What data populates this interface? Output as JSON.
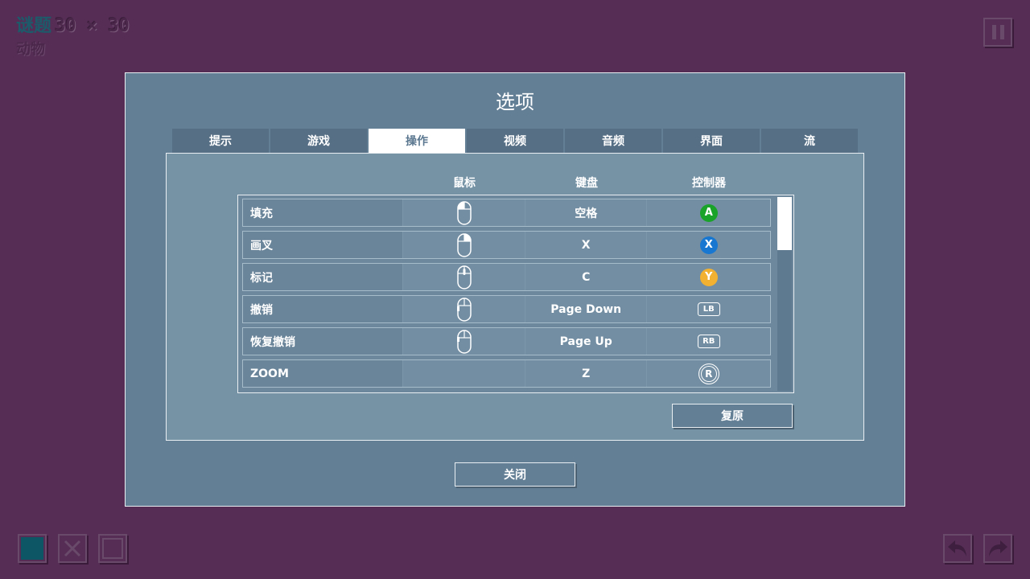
{
  "hud": {
    "puzzle_label": "谜题",
    "puzzle_size": "30 × 30",
    "puzzle_category": "动物"
  },
  "dialog": {
    "title": "选项",
    "tabs": [
      {
        "label": "提示",
        "active": false
      },
      {
        "label": "游戏",
        "active": false
      },
      {
        "label": "操作",
        "active": true
      },
      {
        "label": "视频",
        "active": false
      },
      {
        "label": "音频",
        "active": false
      },
      {
        "label": "界面",
        "active": false
      },
      {
        "label": "流",
        "active": false
      }
    ],
    "columns": {
      "mouse": "鼠标",
      "keyboard": "键盘",
      "controller": "控制器"
    },
    "bindings": [
      {
        "action": "填充",
        "mouse": "left-click",
        "keyboard": "空格",
        "controller": {
          "type": "face",
          "label": "A",
          "color": "#1aa329"
        }
      },
      {
        "action": "画叉",
        "mouse": "right-click",
        "keyboard": "X",
        "controller": {
          "type": "face",
          "label": "X",
          "color": "#1877d0"
        }
      },
      {
        "action": "标记",
        "mouse": "middle-click",
        "keyboard": "C",
        "controller": {
          "type": "face",
          "label": "Y",
          "color": "#f2b130"
        }
      },
      {
        "action": "撤销",
        "mouse": "back-button",
        "keyboard": "Page Down",
        "controller": {
          "type": "bumper",
          "label": "LB"
        }
      },
      {
        "action": "恢复撤销",
        "mouse": "forward-button",
        "keyboard": "Page Up",
        "controller": {
          "type": "bumper",
          "label": "RB"
        }
      },
      {
        "action": "ZOOM",
        "mouse": "",
        "keyboard": "Z",
        "controller": {
          "type": "stick",
          "label": "R"
        }
      }
    ],
    "reset_label": "复原",
    "close_label": "关闭"
  },
  "colors": {
    "background": "#552d55",
    "dialog": "#637f96",
    "panel": "#7693a6",
    "accent_fill": "#0d5666"
  },
  "icons": {
    "pause": "pause-icon",
    "fill_tool": "fill-swatch-icon",
    "cross_tool": "cross-icon",
    "mark_tool": "square-outline-icon",
    "undo": "undo-arrow-icon",
    "redo": "redo-arrow-icon"
  }
}
